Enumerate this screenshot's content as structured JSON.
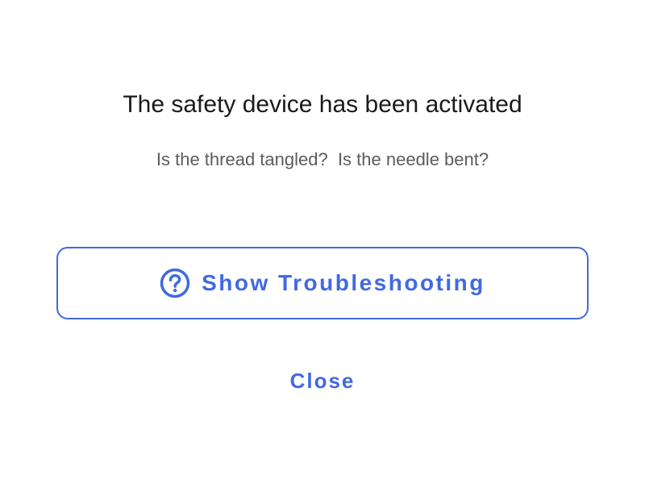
{
  "dialog": {
    "title": "The safety device has been activated",
    "message": "Is the thread tangled?  Is the needle bent?",
    "troubleshoot_button": {
      "label": "Show Troubleshooting",
      "icon": "question-circle-icon"
    },
    "close_button": {
      "label": "Close"
    }
  },
  "colors": {
    "accent": "#4169e1",
    "title_text": "#1a1a1a",
    "message_text": "#5c5c5c",
    "background": "#ffffff"
  }
}
